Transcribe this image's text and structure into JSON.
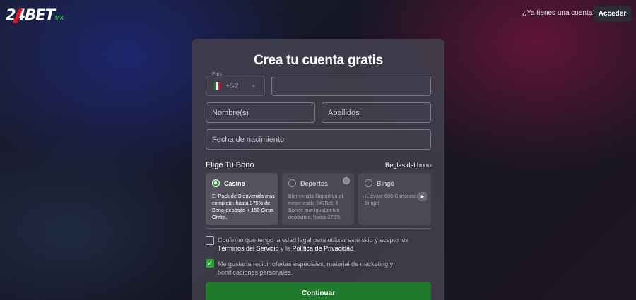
{
  "header": {
    "logo_text": "24BET",
    "logo_suffix": "MX",
    "have_account_text": "¿Ya tienes una cuenta?",
    "login_label": "Acceder"
  },
  "form": {
    "title": "Crea tu cuenta gratis",
    "country_label": "País",
    "dial_code": "+52",
    "phone_placeholder": "",
    "first_name_placeholder": "Nombre(s)",
    "last_name_placeholder": "Apellidos",
    "dob_placeholder": "Fecha de nacimiento",
    "bonus_title": "Elige Tu Bono",
    "bonus_rules_label": "Reglas del bono",
    "bonus_options": [
      {
        "name": "Casino",
        "description": "El Pack de Bienvenida más completo: hasta 375% de Bono-depósito + 150 Giros Gratis.",
        "selected": true
      },
      {
        "name": "Deportes",
        "description": "Bienvenida Deportiva al mejor estilo 247Bet: 3 Bonos que igualan tus depósitos, hasta 375%",
        "selected": false
      },
      {
        "name": "Bingo",
        "description": "¡Llévate 600 Cartones de Bingo!",
        "selected": false
      }
    ],
    "consent_age": {
      "checked": false,
      "text_before": "Confirmo que tengo la edad legal para utilizar este sitio y acepto los ",
      "terms_link": "Términos del Servicio",
      "text_mid": " y la ",
      "privacy_link": "Política de Privacidad"
    },
    "consent_marketing": {
      "checked": true,
      "text": "Me gustaría recibir ofertas especiales, material de marketing y bonificaciones personales."
    },
    "continue_label": "Continuar"
  },
  "colors": {
    "accent_green": "#2fa33a",
    "button_green": "#1f7a2d",
    "logo_red": "#e0162b"
  }
}
